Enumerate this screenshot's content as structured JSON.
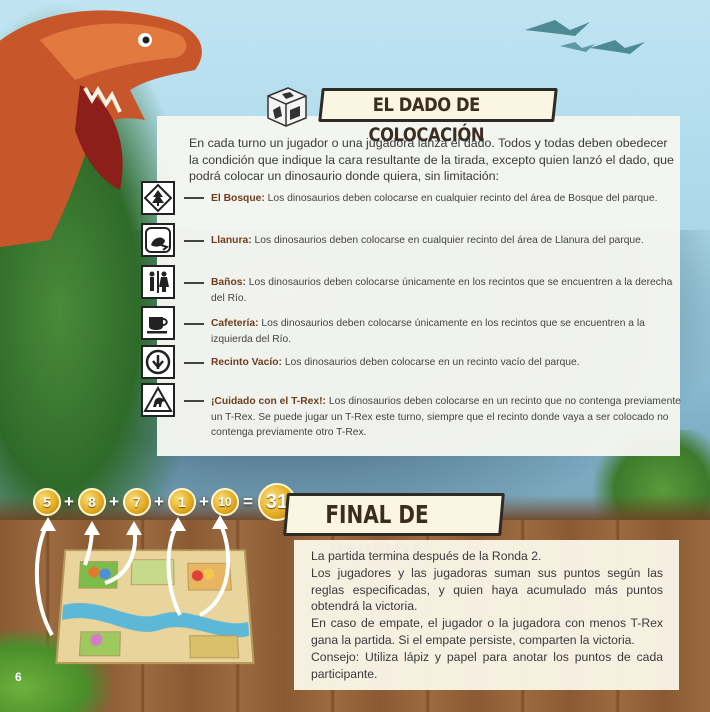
{
  "placement_die": {
    "title": "EL DADO DE COLOCACIÓN",
    "intro": "En cada turno un jugador o una jugadora lanza el dado. Todos y todas deben obedecer la condición que indique la cara resultante de la tirada, excepto quien lanzó el dado, que podrá colocar un dinosaurio donde quiera, sin limitación:",
    "rules": [
      {
        "icon": "forest-icon",
        "term": "El Bosque:",
        "text": " Los dinosaurios deben colocarse en cualquier recinto del área de Bosque del parque."
      },
      {
        "icon": "grassland-icon",
        "term": "Llanura:",
        "text": " Los dinosaurios deben colocarse en cualquier recinto del área de Llanura del parque."
      },
      {
        "icon": "restroom-icon",
        "term": "Baños:",
        "text": " Los dinosaurios deben colocarse únicamente en los recintos que se encuentren a la derecha del Río."
      },
      {
        "icon": "cafe-icon",
        "term": "Cafetería:",
        "text": "  Los dinosaurios  deben colocarse únicamente en los recintos que se encuentren a la izquierda del Río."
      },
      {
        "icon": "empty-enclosure-icon",
        "term": "Recinto Vacío:",
        "text": " Los dinosaurios deben colocarse en un recinto vacío del parque."
      },
      {
        "icon": "t-rex-warning-icon",
        "term": "¡Cuidado con el T-Rex!:",
        "text": " Los dinosaurios deben colocarse en un recinto que no contenga previamente un T-Rex. Se puede jugar un T-Rex este turno, siempre que el recinto donde vaya a ser colocado no contenga previamente otro T-Rex."
      }
    ]
  },
  "score_example": {
    "values": [
      "5",
      "8",
      "7",
      "1",
      "10"
    ],
    "plus": "+",
    "equals": "=",
    "total": "31"
  },
  "end_game": {
    "title": "FINAL DE PARTIDA",
    "paragraphs": [
      "La partida termina después de la Ronda 2.",
      "Los jugadores y las jugadoras suman sus puntos según las reglas especificadas, y quien haya acumulado más puntos obtendrá la victoria.",
      "En caso de empate, el jugador o la jugadora con menos T-Rex gana la partida. Si el empate persiste, comparten la victoria.",
      "Consejo: Utiliza lápiz y papel para anotar los puntos de cada participante."
    ]
  },
  "page_number": "6"
}
